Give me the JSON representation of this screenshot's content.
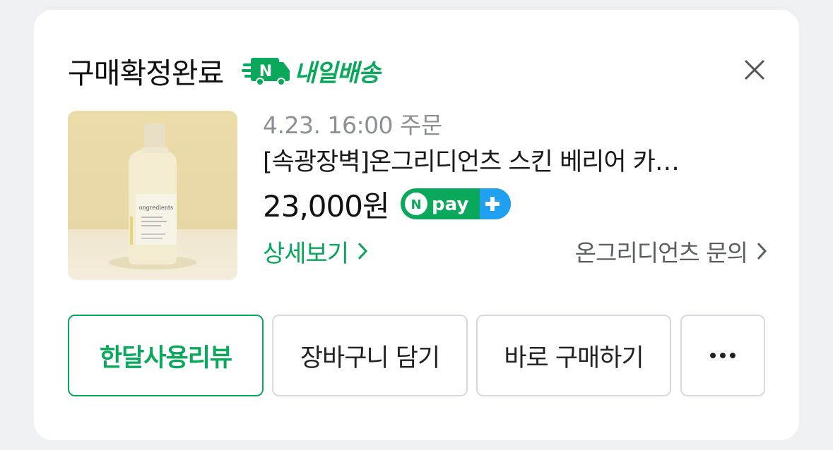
{
  "order": {
    "status_title": "구매확정완료",
    "delivery_badge": "내일배송",
    "delivery_badge_icon_text": "N",
    "order_date": "4.23. 16:00 주문",
    "product_name": "[속광장벽]온그리디언츠 스킨 베리어 카…",
    "price": "23,000원",
    "payment_badge": {
      "text": "pay",
      "mark": "N"
    },
    "detail_link": "상세보기",
    "inquiry_link": "온그리디언츠 문의",
    "product_image_label": "ongredients"
  },
  "actions": {
    "review": "한달사용리뷰",
    "add_to_cart": "장바구니 담기",
    "buy_now": "바로 구매하기",
    "more_icon": "more-horizontal-icon"
  },
  "colors": {
    "accent_green": "#0aa85a",
    "npay_blue": "#1fa0f0",
    "background": "#eef0f3",
    "card": "#ffffff"
  }
}
